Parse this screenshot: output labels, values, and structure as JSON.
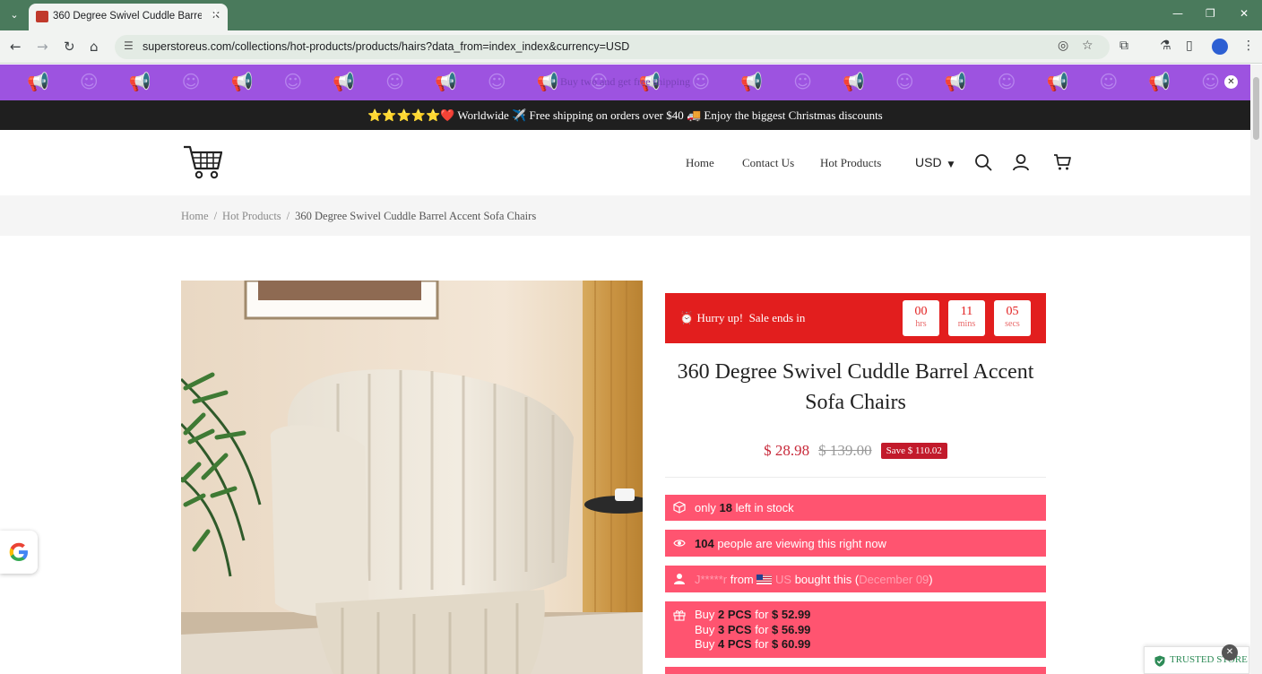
{
  "browser": {
    "tab_title": "360 Degree Swivel Cuddle Barrel Accent Sofa Chairs",
    "url": "superstoreus.com/collections/hot-products/products/hairs?data_from=index_index&currency=USD"
  },
  "promo_bar": {
    "text": "Buy two and get free shipping"
  },
  "announcement": {
    "text": "⭐⭐⭐⭐⭐❤️ Worldwide ✈️ Free shipping on orders over $40 🚚 Enjoy the biggest Christmas discounts"
  },
  "nav": {
    "home": "Home",
    "contact": "Contact Us",
    "hot_products": "Hot Products",
    "currency": "USD"
  },
  "breadcrumb": {
    "home": "Home",
    "category": "Hot Products",
    "current": "360 Degree Swivel Cuddle Barrel Accent Sofa Chairs"
  },
  "countdown": {
    "label": "Hurry up!  Sale ends in",
    "hours": "00",
    "hours_unit": "hrs",
    "mins": "11",
    "mins_unit": "mins",
    "secs": "05",
    "secs_unit": "secs"
  },
  "product": {
    "title": "360 Degree Swivel Cuddle Barrel Accent Sofa Chairs",
    "price": "$ 28.98",
    "compare_price": "$ 139.00",
    "save": "Save $ 110.02"
  },
  "stock": {
    "pre": "only",
    "count": "18",
    "post": "left in stock"
  },
  "viewers": {
    "count": "104",
    "post": "people are viewing this right now"
  },
  "recent_buyer": {
    "name": "J*****r",
    "from": "from",
    "country": "US",
    "action": "bought this (",
    "date": "December 09",
    "close": ")"
  },
  "bundles": [
    {
      "buy": "Buy",
      "qty": "2 PCS",
      "for": "for",
      "price": "$ 52.99"
    },
    {
      "buy": "Buy",
      "qty": "3 PCS",
      "for": "for",
      "price": "$ 56.99"
    },
    {
      "buy": "Buy",
      "qty": "4 PCS",
      "for": "for",
      "price": "$ 60.99"
    }
  ],
  "trusted_store": {
    "label": "TRUSTED STORE"
  },
  "colors": {
    "promo_purple": "#9d53e0",
    "countdown_red": "#e21e1e",
    "info_pink": "#ff5470",
    "price_red": "#c8293a",
    "tab_green": "#4a7a5c"
  }
}
